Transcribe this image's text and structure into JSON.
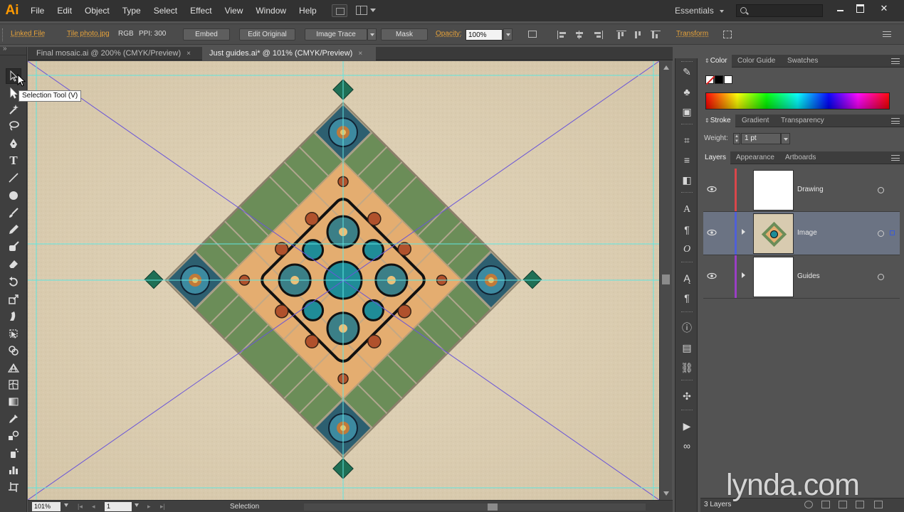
{
  "app": {
    "logo": "Ai"
  },
  "menu": [
    "File",
    "Edit",
    "Object",
    "Type",
    "Select",
    "Effect",
    "View",
    "Window",
    "Help"
  ],
  "workspace": "Essentials",
  "search": {
    "value": ""
  },
  "controlbar": {
    "linked_file": "Linked File",
    "file_name": "Tile photo.jpg",
    "color_mode": "RGB",
    "ppi": "PPI: 300",
    "embed": "Embed",
    "edit_original": "Edit Original",
    "image_trace": "Image Trace",
    "mask": "Mask",
    "opacity_label": "Opacity:",
    "opacity_value": "100%",
    "transform": "Transform"
  },
  "tooltip": "Selection Tool (V)",
  "doc_tabs": [
    {
      "label": "Final mosaic.ai @ 200% (CMYK/Preview)",
      "close": "×"
    },
    {
      "label": "Just guides.ai* @ 101% (CMYK/Preview)",
      "close": "×"
    }
  ],
  "status": {
    "zoom": "101%",
    "page": "1",
    "tool": "Selection"
  },
  "panels": {
    "color_group": [
      "Color",
      "Color Guide",
      "Swatches"
    ],
    "stroke_group": [
      "Stroke",
      "Gradient",
      "Transparency"
    ],
    "weight_label": "Weight:",
    "weight_value": "1 pt",
    "layers_group": [
      "Layers",
      "Appearance",
      "Artboards"
    ],
    "layers": [
      {
        "name": "Drawing",
        "color": "#d9474b"
      },
      {
        "name": "Image",
        "color": "#4f60d8"
      },
      {
        "name": "Guides",
        "color": "#9a3fc4"
      }
    ],
    "layers_count": "3 Layers"
  },
  "tools": [
    "selection-tool",
    "direct-selection-tool",
    "magic-wand-tool",
    "lasso-tool",
    "pen-tool",
    "type-tool",
    "line-tool",
    "ellipse-tool",
    "paintbrush-tool",
    "pencil-tool",
    "blob-brush-tool",
    "eraser-tool",
    "rotate-tool",
    "scale-tool",
    "warp-tool",
    "free-transform-tool",
    "shape-builder-tool",
    "perspective-grid-tool",
    "mesh-tool",
    "gradient-tool",
    "eyedropper-tool",
    "blend-tool",
    "symbol-sprayer-tool",
    "column-graph-tool",
    "artboard-tool"
  ],
  "watermark": "lynda.com",
  "colors": {
    "accent_orange": "#ff9a00",
    "guide_cyan": "#5fe6e0",
    "guide_violet": "#6a55d8",
    "selected_layer": "#6b7383"
  }
}
